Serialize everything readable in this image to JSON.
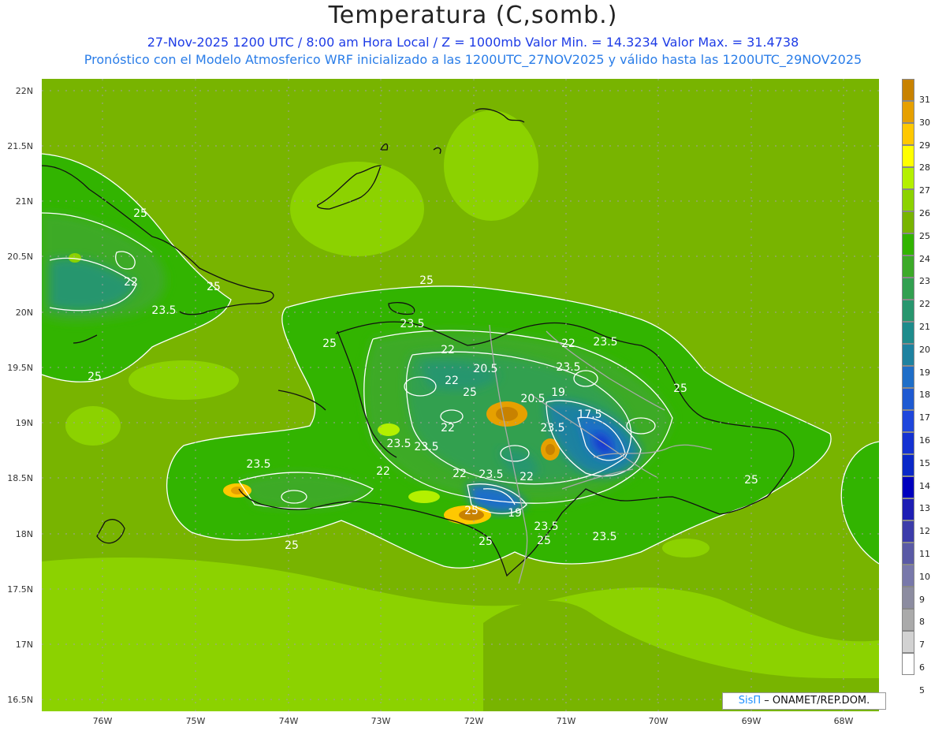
{
  "title": "Temperatura (C,somb.)",
  "subtitle1": "27-Nov-2025  1200 UTC / 8:00 am Hora Local / Z = 1000mb   Valor Min. = 14.3234  Valor Max. = 31.4738",
  "subtitle2": "Pronóstico con el Modelo Atmosferico WRF inicializado a las 1200UTC_27NOV2025 y válido hasta las  1200UTC_29NOV2025",
  "lat_labels": [
    "22N",
    "21.5N",
    "21N",
    "20.5N",
    "20N",
    "19.5N",
    "19N",
    "18.5N",
    "18N",
    "17.5N",
    "17N",
    "16.5N"
  ],
  "lon_labels": [
    "76W",
    "75W",
    "74W",
    "73W",
    "72W",
    "71W",
    "70W",
    "69W",
    "68W"
  ],
  "colorbar": {
    "labels": [
      "31",
      "30",
      "29",
      "28",
      "27",
      "26",
      "25",
      "24",
      "23",
      "22",
      "21",
      "20",
      "19",
      "18",
      "17",
      "16",
      "15",
      "14",
      "13",
      "12",
      "11",
      "10",
      "9",
      "8",
      "7",
      "6",
      "5"
    ],
    "colors": [
      "#c88200",
      "#e6a000",
      "#ffc800",
      "#ffff00",
      "#b4f000",
      "#8cd200",
      "#78b400",
      "#32b400",
      "#3caa28",
      "#32a050",
      "#28966e",
      "#1e8c8c",
      "#1e82a0",
      "#1e6ec8",
      "#1e5ad2",
      "#1e46dc",
      "#1432d2",
      "#0a28c8",
      "#0000be",
      "#1e1eb4",
      "#3c3caa",
      "#5a5aa5",
      "#7878aa",
      "#8c8ca0",
      "#aaaaaa",
      "#d2d2d2",
      "#ffffff"
    ]
  },
  "contour_labels": [
    "25",
    "22",
    "25",
    "23.5",
    "25",
    "25",
    "23.5",
    "25",
    "22",
    "22",
    "23.5",
    "20.5",
    "23.5",
    "22",
    "25",
    "19",
    "20.5",
    "17.5",
    "25",
    "23.5",
    "22",
    "25",
    "23.5",
    "23.5",
    "23.5",
    "22",
    "23.5",
    "22",
    "22",
    "25",
    "19",
    "23.5",
    "25",
    "25",
    "23.5",
    "25"
  ],
  "credit": {
    "sis": "SisΠ",
    "rest": " – ONAMET/REP.DOM."
  }
}
